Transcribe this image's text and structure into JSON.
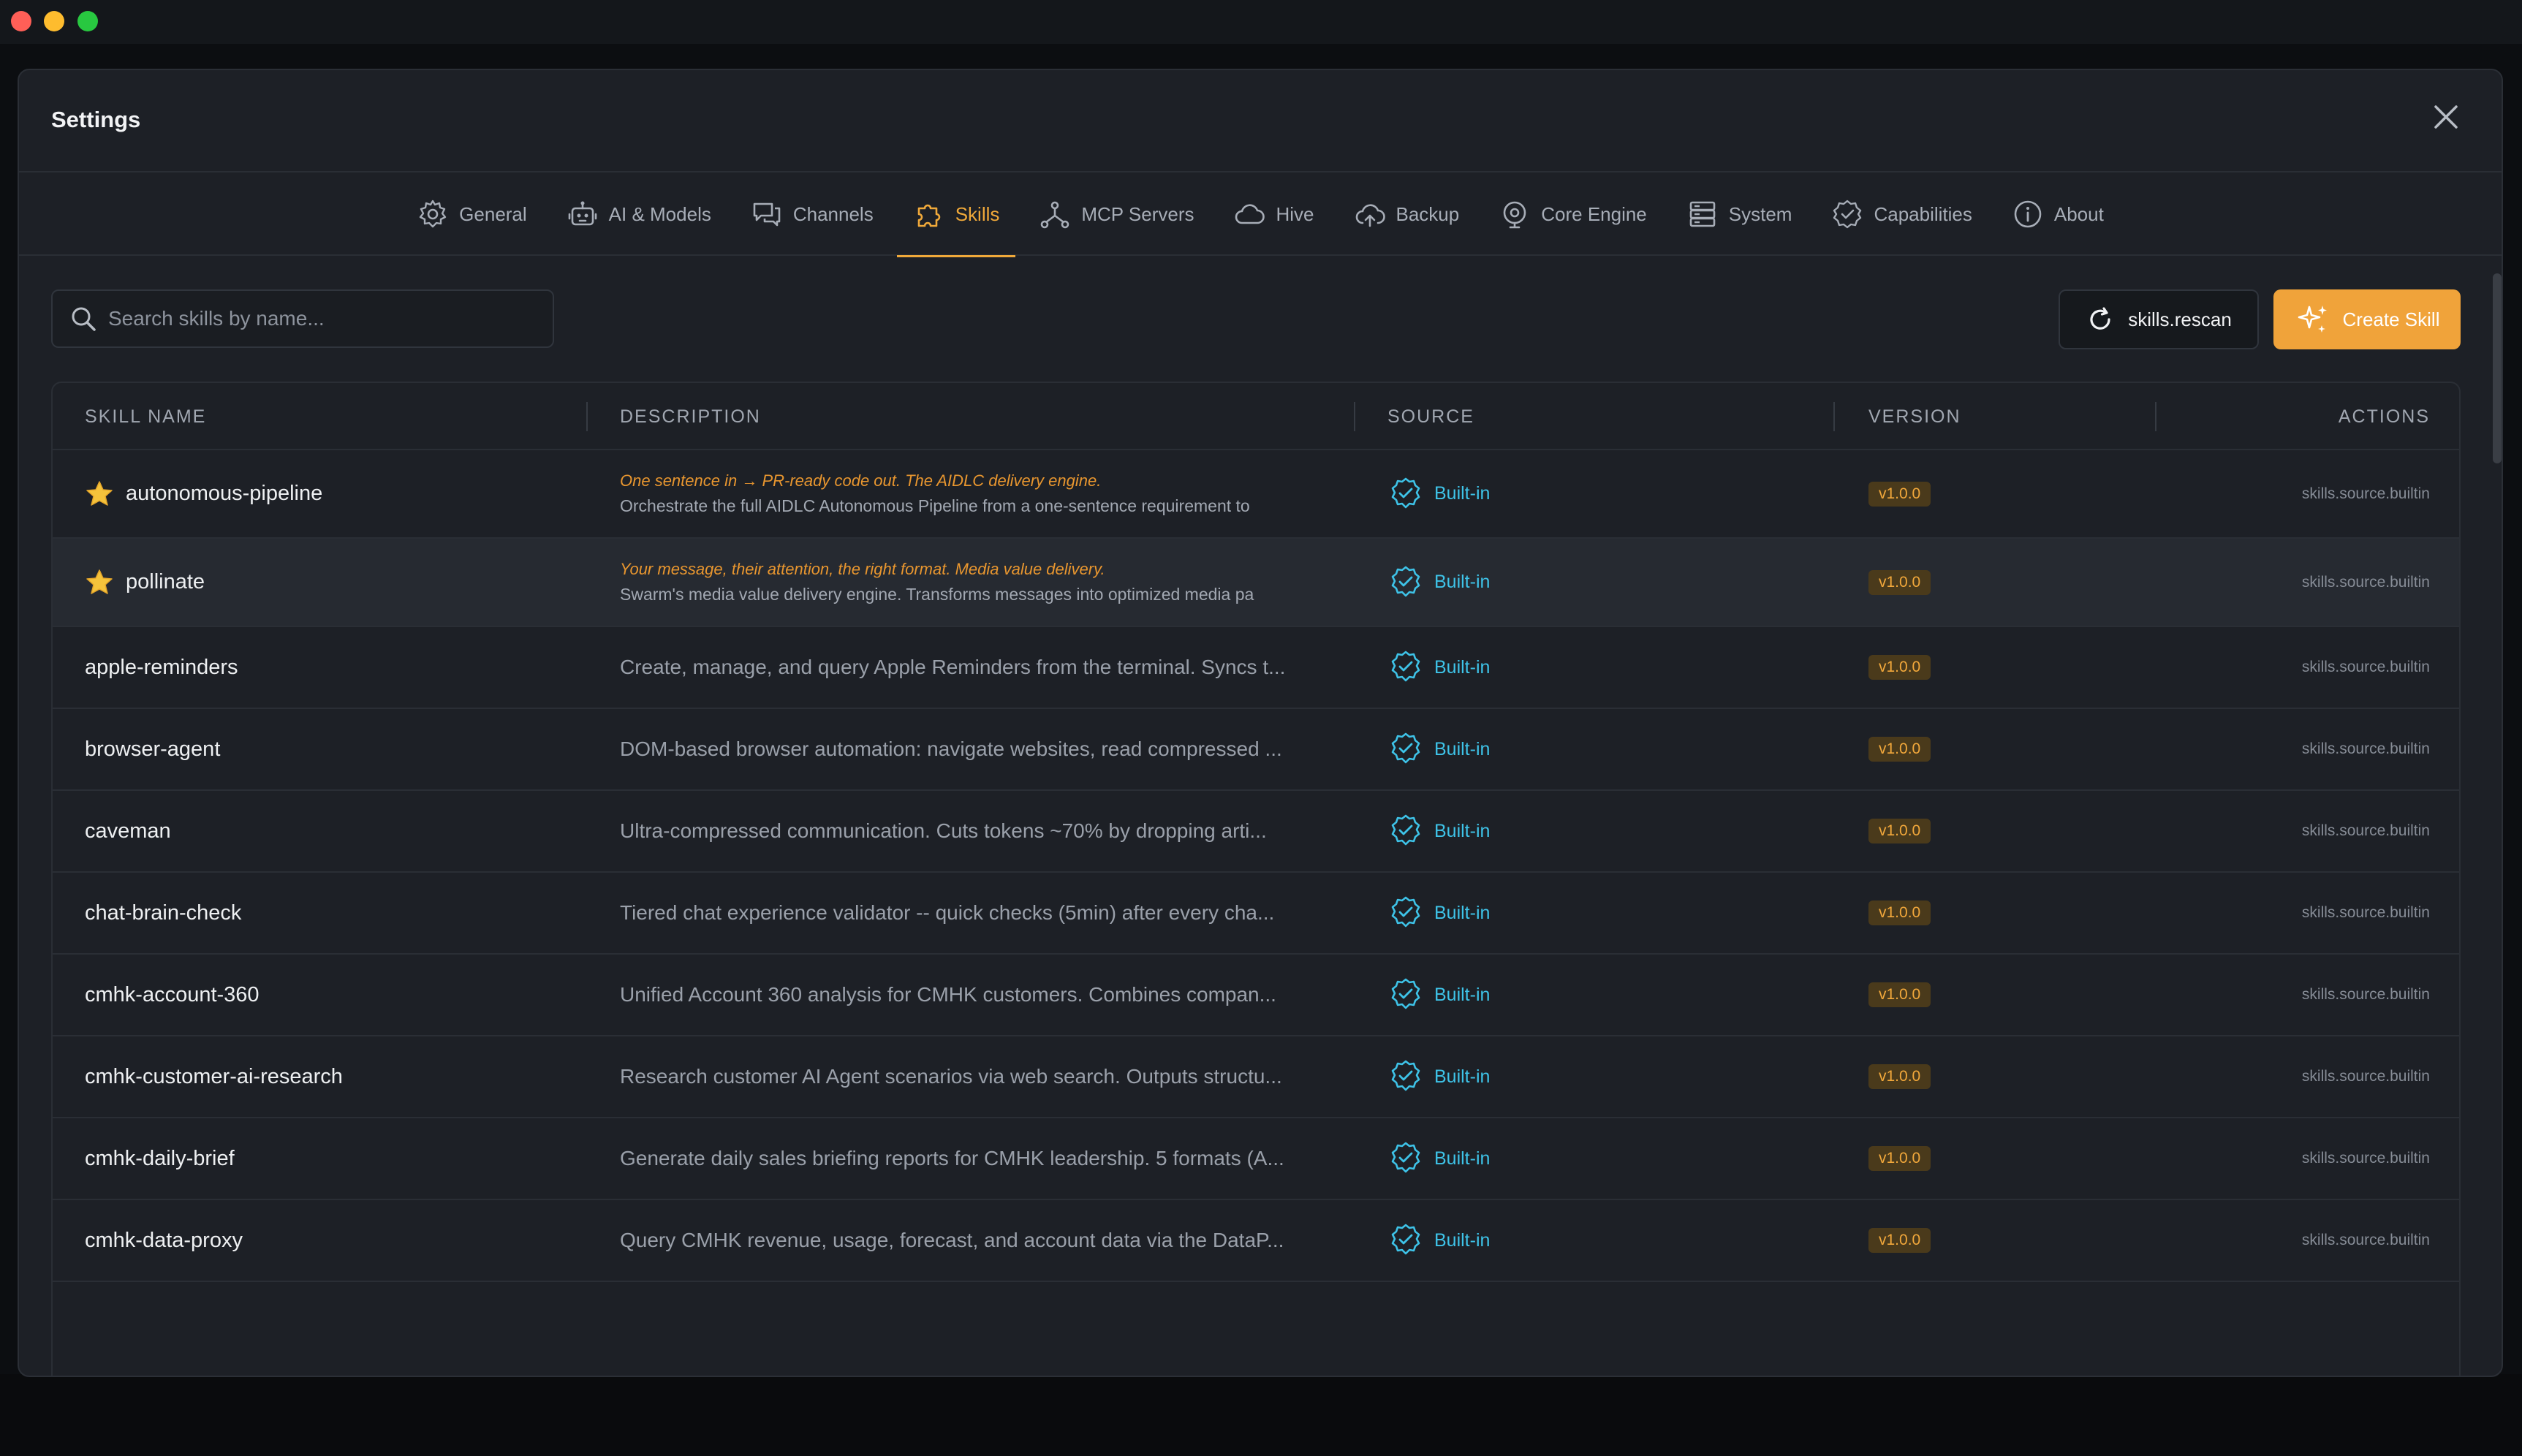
{
  "window": {
    "title": "Settings"
  },
  "tabs": [
    {
      "label": "General",
      "icon": "gear-icon",
      "active": false
    },
    {
      "label": "AI & Models",
      "icon": "robot-icon",
      "active": false
    },
    {
      "label": "Channels",
      "icon": "chat-icon",
      "active": false
    },
    {
      "label": "Skills",
      "icon": "puzzle-icon",
      "active": true
    },
    {
      "label": "MCP Servers",
      "icon": "network-icon",
      "active": false
    },
    {
      "label": "Hive",
      "icon": "cloud-icon",
      "active": false
    },
    {
      "label": "Backup",
      "icon": "cloud-upload-icon",
      "active": false
    },
    {
      "label": "Core Engine",
      "icon": "engine-icon",
      "active": false
    },
    {
      "label": "System",
      "icon": "server-icon",
      "active": false
    },
    {
      "label": "Capabilities",
      "icon": "badge-check-icon",
      "active": false
    },
    {
      "label": "About",
      "icon": "info-icon",
      "active": false
    }
  ],
  "search": {
    "placeholder": "Search skills by name...",
    "value": ""
  },
  "toolbar": {
    "rescan_label": "skills.rescan",
    "create_label": "Create Skill"
  },
  "table": {
    "headers": {
      "name": "SKILL NAME",
      "description": "DESCRIPTION",
      "source": "SOURCE",
      "version": "VERSION",
      "actions": "ACTIONS"
    },
    "rows": [
      {
        "name": "autonomous-pipeline",
        "featured": true,
        "tagline": "One sentence in → PR-ready code out. The AIDLC delivery engine.",
        "description": "Orchestrate the full AIDLC Autonomous Pipeline from a one-sentence requirement to",
        "source": "Built-in",
        "version": "v1.0.0",
        "actions": "skills.source.builtin"
      },
      {
        "name": "pollinate",
        "featured": true,
        "tagline": "Your message, their attention, the right format. Media value delivery.",
        "description": "Swarm's media value delivery engine. Transforms messages into optimized media pa",
        "source": "Built-in",
        "version": "v1.0.0",
        "actions": "skills.source.builtin"
      },
      {
        "name": "apple-reminders",
        "featured": false,
        "tagline": "",
        "description": "Create, manage, and query Apple Reminders from the terminal. Syncs t...",
        "source": "Built-in",
        "version": "v1.0.0",
        "actions": "skills.source.builtin"
      },
      {
        "name": "browser-agent",
        "featured": false,
        "tagline": "",
        "description": "DOM-based browser automation: navigate websites, read compressed ...",
        "source": "Built-in",
        "version": "v1.0.0",
        "actions": "skills.source.builtin"
      },
      {
        "name": "caveman",
        "featured": false,
        "tagline": "",
        "description": "Ultra-compressed communication. Cuts tokens ~70% by dropping arti...",
        "source": "Built-in",
        "version": "v1.0.0",
        "actions": "skills.source.builtin"
      },
      {
        "name": "chat-brain-check",
        "featured": false,
        "tagline": "",
        "description": "Tiered chat experience validator -- quick checks (5min) after every cha...",
        "source": "Built-in",
        "version": "v1.0.0",
        "actions": "skills.source.builtin"
      },
      {
        "name": "cmhk-account-360",
        "featured": false,
        "tagline": "",
        "description": "Unified Account 360 analysis for CMHK customers. Combines compan...",
        "source": "Built-in",
        "version": "v1.0.0",
        "actions": "skills.source.builtin"
      },
      {
        "name": "cmhk-customer-ai-research",
        "featured": false,
        "tagline": "",
        "description": "Research customer AI Agent scenarios via web search. Outputs structu...",
        "source": "Built-in",
        "version": "v1.0.0",
        "actions": "skills.source.builtin"
      },
      {
        "name": "cmhk-daily-brief",
        "featured": false,
        "tagline": "",
        "description": "Generate daily sales briefing reports for CMHK leadership. 5 formats (A...",
        "source": "Built-in",
        "version": "v1.0.0",
        "actions": "skills.source.builtin"
      },
      {
        "name": "cmhk-data-proxy",
        "featured": false,
        "tagline": "",
        "description": "Query CMHK revenue, usage, forecast, and account data via the DataP...",
        "source": "Built-in",
        "version": "v1.0.0",
        "actions": "skills.source.builtin"
      }
    ]
  },
  "colors": {
    "accent": "#f0a93a",
    "source_link": "#3ec3e8",
    "modal_bg": "#1d2026",
    "version_badge_bg": "#4a3a1b"
  }
}
